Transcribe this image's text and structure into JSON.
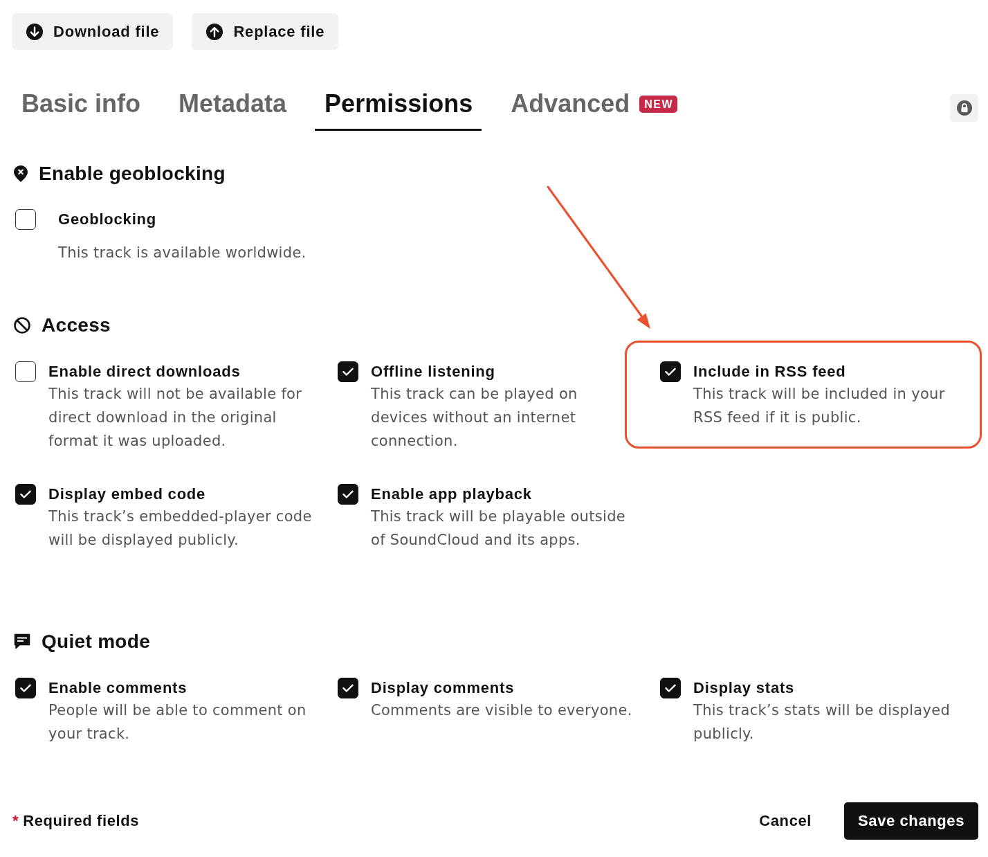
{
  "toolbar": {
    "buttons": [
      {
        "kind": "download",
        "label": "Download file"
      },
      {
        "kind": "replace",
        "label": "Replace file"
      }
    ]
  },
  "tabs": [
    {
      "label": "Basic info",
      "selected": false
    },
    {
      "label": "Metadata",
      "selected": false
    },
    {
      "label": "Permissions",
      "selected": true
    },
    {
      "label": "Advanced",
      "selected": false,
      "badge": "NEW"
    }
  ],
  "sections": [
    {
      "kind": "geoblocking",
      "title": "Enable geoblocking",
      "options": [
        {
          "label": "Geoblocking",
          "description": "This track is available worldwide.",
          "checked": false,
          "highlighted": false
        }
      ]
    },
    {
      "kind": "access",
      "title": "Access",
      "options": [
        {
          "label": "Enable direct downloads",
          "description": "This track will not be available for direct download in the original format it was uploaded.",
          "checked": false,
          "highlighted": false
        },
        {
          "label": "Offline listening",
          "description": "This track can be played on devices without an internet connection.",
          "checked": true,
          "highlighted": false
        },
        {
          "label": "Include in RSS feed",
          "description": "This track will be included in your RSS feed if it is public.",
          "checked": true,
          "highlighted": true
        },
        {
          "label": "Display embed code",
          "description": "This track’s embedded-player code will be displayed publicly.",
          "checked": true,
          "highlighted": false
        },
        {
          "label": "Enable app playback",
          "description": "This track will be playable outside of SoundCloud and its apps.",
          "checked": true,
          "highlighted": false
        }
      ]
    },
    {
      "kind": "quiet_mode",
      "title": "Quiet mode",
      "options": [
        {
          "label": "Enable comments",
          "description": "People will be able to comment on your track.",
          "checked": true,
          "highlighted": false
        },
        {
          "label": "Display comments",
          "description": "Comments are visible to everyone.",
          "checked": true,
          "highlighted": false
        },
        {
          "label": "Display stats",
          "description": "This track’s stats will be displayed publicly.",
          "checked": true,
          "highlighted": false
        }
      ]
    }
  ],
  "footer": {
    "required_mark": "*",
    "required_label": "Required fields",
    "cancel": "Cancel",
    "save": "Save changes"
  }
}
